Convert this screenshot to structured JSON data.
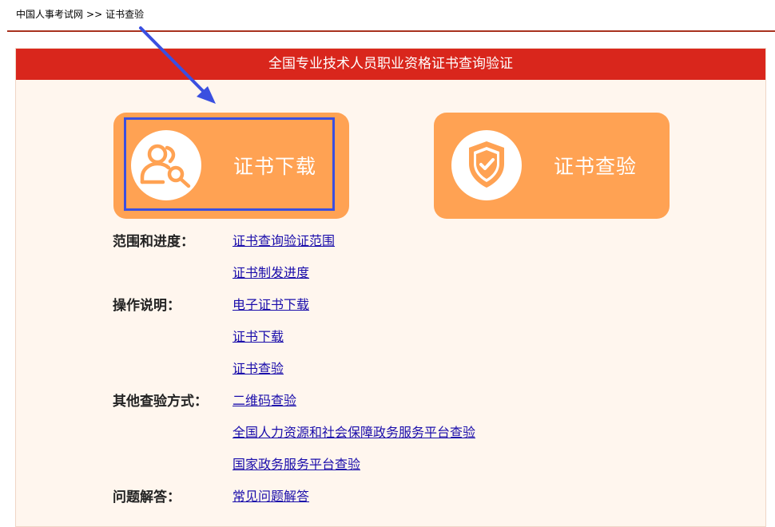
{
  "breadcrumb": {
    "home": "中国人事考试网",
    "separator": ">>",
    "current": "证书查验"
  },
  "panel": {
    "title": "全国专业技术人员职业资格证书查询验证"
  },
  "buttons": {
    "download": {
      "label": "证书下载",
      "icon": "user-search-icon"
    },
    "verify": {
      "label": "证书查验",
      "icon": "shield-check-icon"
    }
  },
  "sections": [
    {
      "label": "范围和进度：",
      "links": [
        "证书查询验证范围",
        "证书制发进度"
      ]
    },
    {
      "label": "操作说明：",
      "links": [
        "电子证书下载",
        "证书下载",
        "证书查验"
      ]
    },
    {
      "label": "其他查验方式：",
      "links": [
        "二维码查验",
        "全国人力资源和社会保障政务服务平台查验",
        "国家政务服务平台查验"
      ]
    },
    {
      "label": "问题解答：",
      "links": [
        "常见问题解答"
      ]
    }
  ],
  "colors": {
    "header_red": "#d9261c",
    "button_orange": "#ffa253",
    "panel_bg": "#fff6ee",
    "link_blue": "#1a0dab",
    "annotation_blue": "#3a4fe0"
  }
}
